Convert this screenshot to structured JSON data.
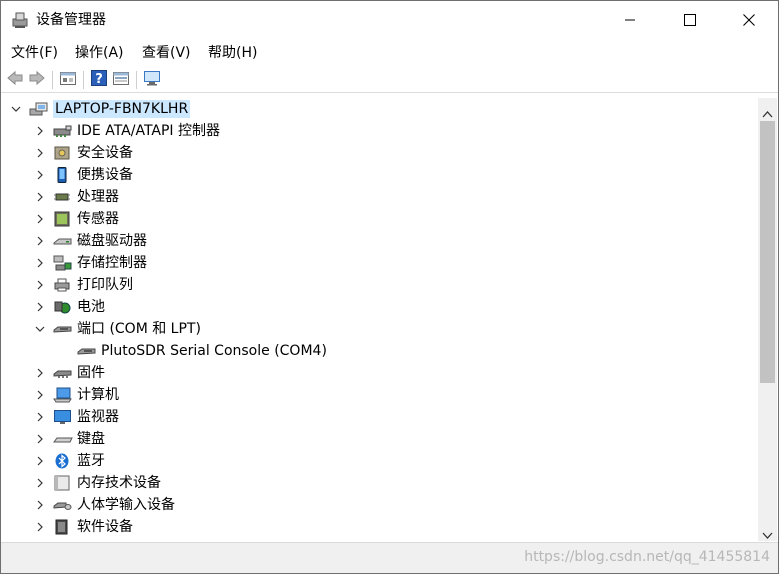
{
  "window": {
    "title": "设备管理器"
  },
  "menu": [
    {
      "label": "文件(F)"
    },
    {
      "label": "操作(A)"
    },
    {
      "label": "查看(V)"
    },
    {
      "label": "帮助(H)"
    }
  ],
  "toolbar": {
    "buttons": [
      "back-icon",
      "forward-icon",
      "properties-icon",
      "help-icon",
      "view-icon",
      "monitor-icon"
    ]
  },
  "tree": {
    "root": {
      "label": "LAPTOP-FBN7KLHR",
      "expanded": true
    },
    "items": [
      {
        "label": "IDE ATA/ATAPI 控制器",
        "icon": "ide-controller-icon",
        "expanded": false
      },
      {
        "label": "安全设备",
        "icon": "security-device-icon",
        "expanded": false
      },
      {
        "label": "便携设备",
        "icon": "portable-device-icon",
        "expanded": false
      },
      {
        "label": "处理器",
        "icon": "processor-icon",
        "expanded": false
      },
      {
        "label": "传感器",
        "icon": "sensor-icon",
        "expanded": false
      },
      {
        "label": "磁盘驱动器",
        "icon": "disk-drive-icon",
        "expanded": false
      },
      {
        "label": "存储控制器",
        "icon": "storage-controller-icon",
        "expanded": false
      },
      {
        "label": "打印队列",
        "icon": "print-queue-icon",
        "expanded": false
      },
      {
        "label": "电池",
        "icon": "battery-icon",
        "expanded": false
      },
      {
        "label": "端口 (COM 和 LPT)",
        "icon": "port-icon",
        "expanded": true,
        "children": [
          {
            "label": "PlutoSDR Serial Console (COM4)",
            "icon": "port-icon"
          }
        ]
      },
      {
        "label": "固件",
        "icon": "firmware-icon",
        "expanded": false
      },
      {
        "label": "计算机",
        "icon": "computer-icon",
        "expanded": false
      },
      {
        "label": "监视器",
        "icon": "monitor-icon",
        "expanded": false
      },
      {
        "label": "键盘",
        "icon": "keyboard-icon",
        "expanded": false
      },
      {
        "label": "蓝牙",
        "icon": "bluetooth-icon",
        "expanded": false
      },
      {
        "label": "内存技术设备",
        "icon": "memory-device-icon",
        "expanded": false
      },
      {
        "label": "人体学输入设备",
        "icon": "hid-icon",
        "expanded": false
      },
      {
        "label": "软件设备",
        "icon": "software-device-icon",
        "expanded": false
      }
    ]
  },
  "status": {
    "watermark": "https://blog.csdn.net/qq_41455814"
  },
  "colors": {
    "selection": "#cce8ff",
    "scrollbar_thumb": "#c2c2c2",
    "accent": "#1f6fd1"
  }
}
